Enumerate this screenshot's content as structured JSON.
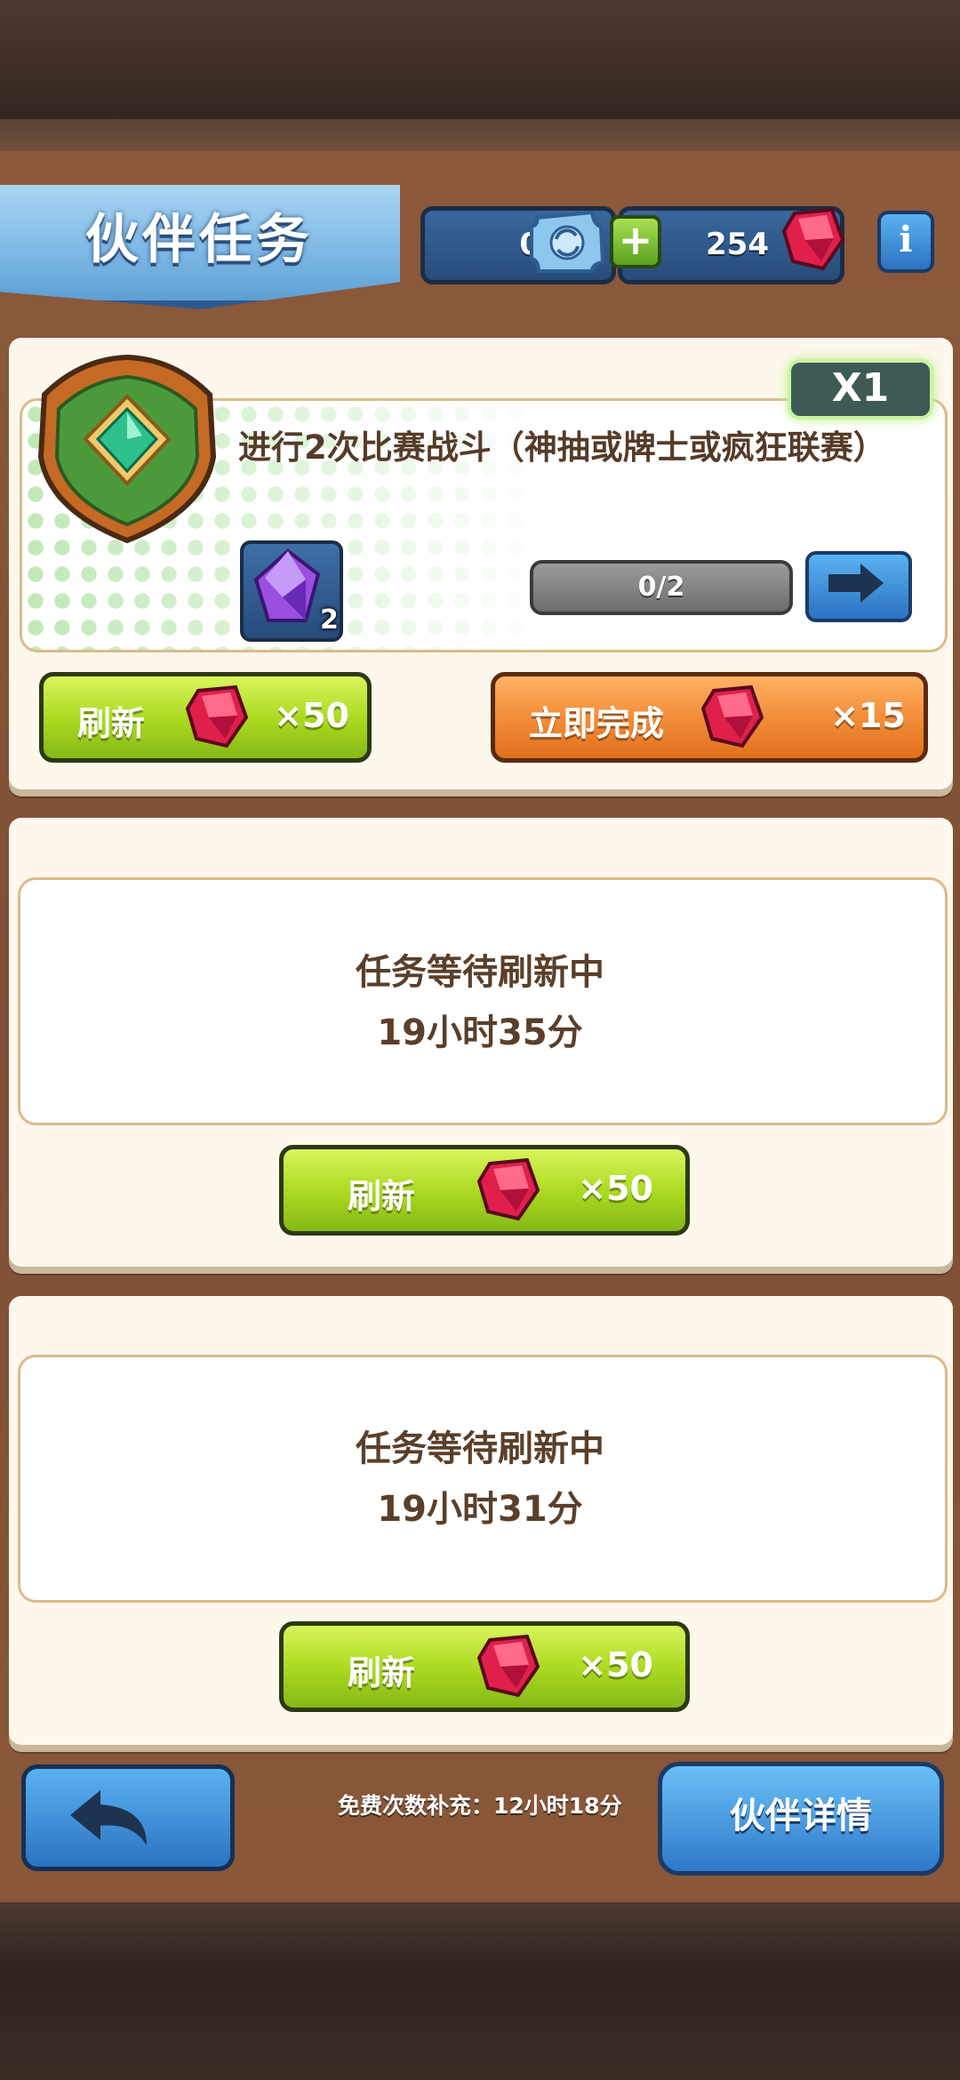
{
  "header": {
    "title": "伙伴任务",
    "tickets": "0",
    "gems": "254",
    "info_label": "i",
    "plus_label": "+"
  },
  "task": {
    "multiplier": "X1",
    "description": "进行2次比赛战斗（神抽或牌士或疯狂联赛）",
    "reward_count": "2",
    "progress": "0/2",
    "refresh_label": "刷新",
    "refresh_cost": "×50",
    "complete_label": "立即完成",
    "complete_cost": "×15"
  },
  "slots": [
    {
      "status": "任务等待刷新中",
      "time": "19小时35分",
      "refresh_label": "刷新",
      "refresh_cost": "×50"
    },
    {
      "status": "任务等待刷新中",
      "time": "19小时31分",
      "refresh_label": "刷新",
      "refresh_cost": "×50"
    }
  ],
  "footer": {
    "free_refill": "免费次数补充：12小时18分",
    "detail_label": "伙伴详情"
  },
  "colors": {
    "gem": "#e0204a",
    "green_button": "#a8d81e",
    "orange_button": "#f28a36",
    "blue_button": "#2c72c2"
  }
}
